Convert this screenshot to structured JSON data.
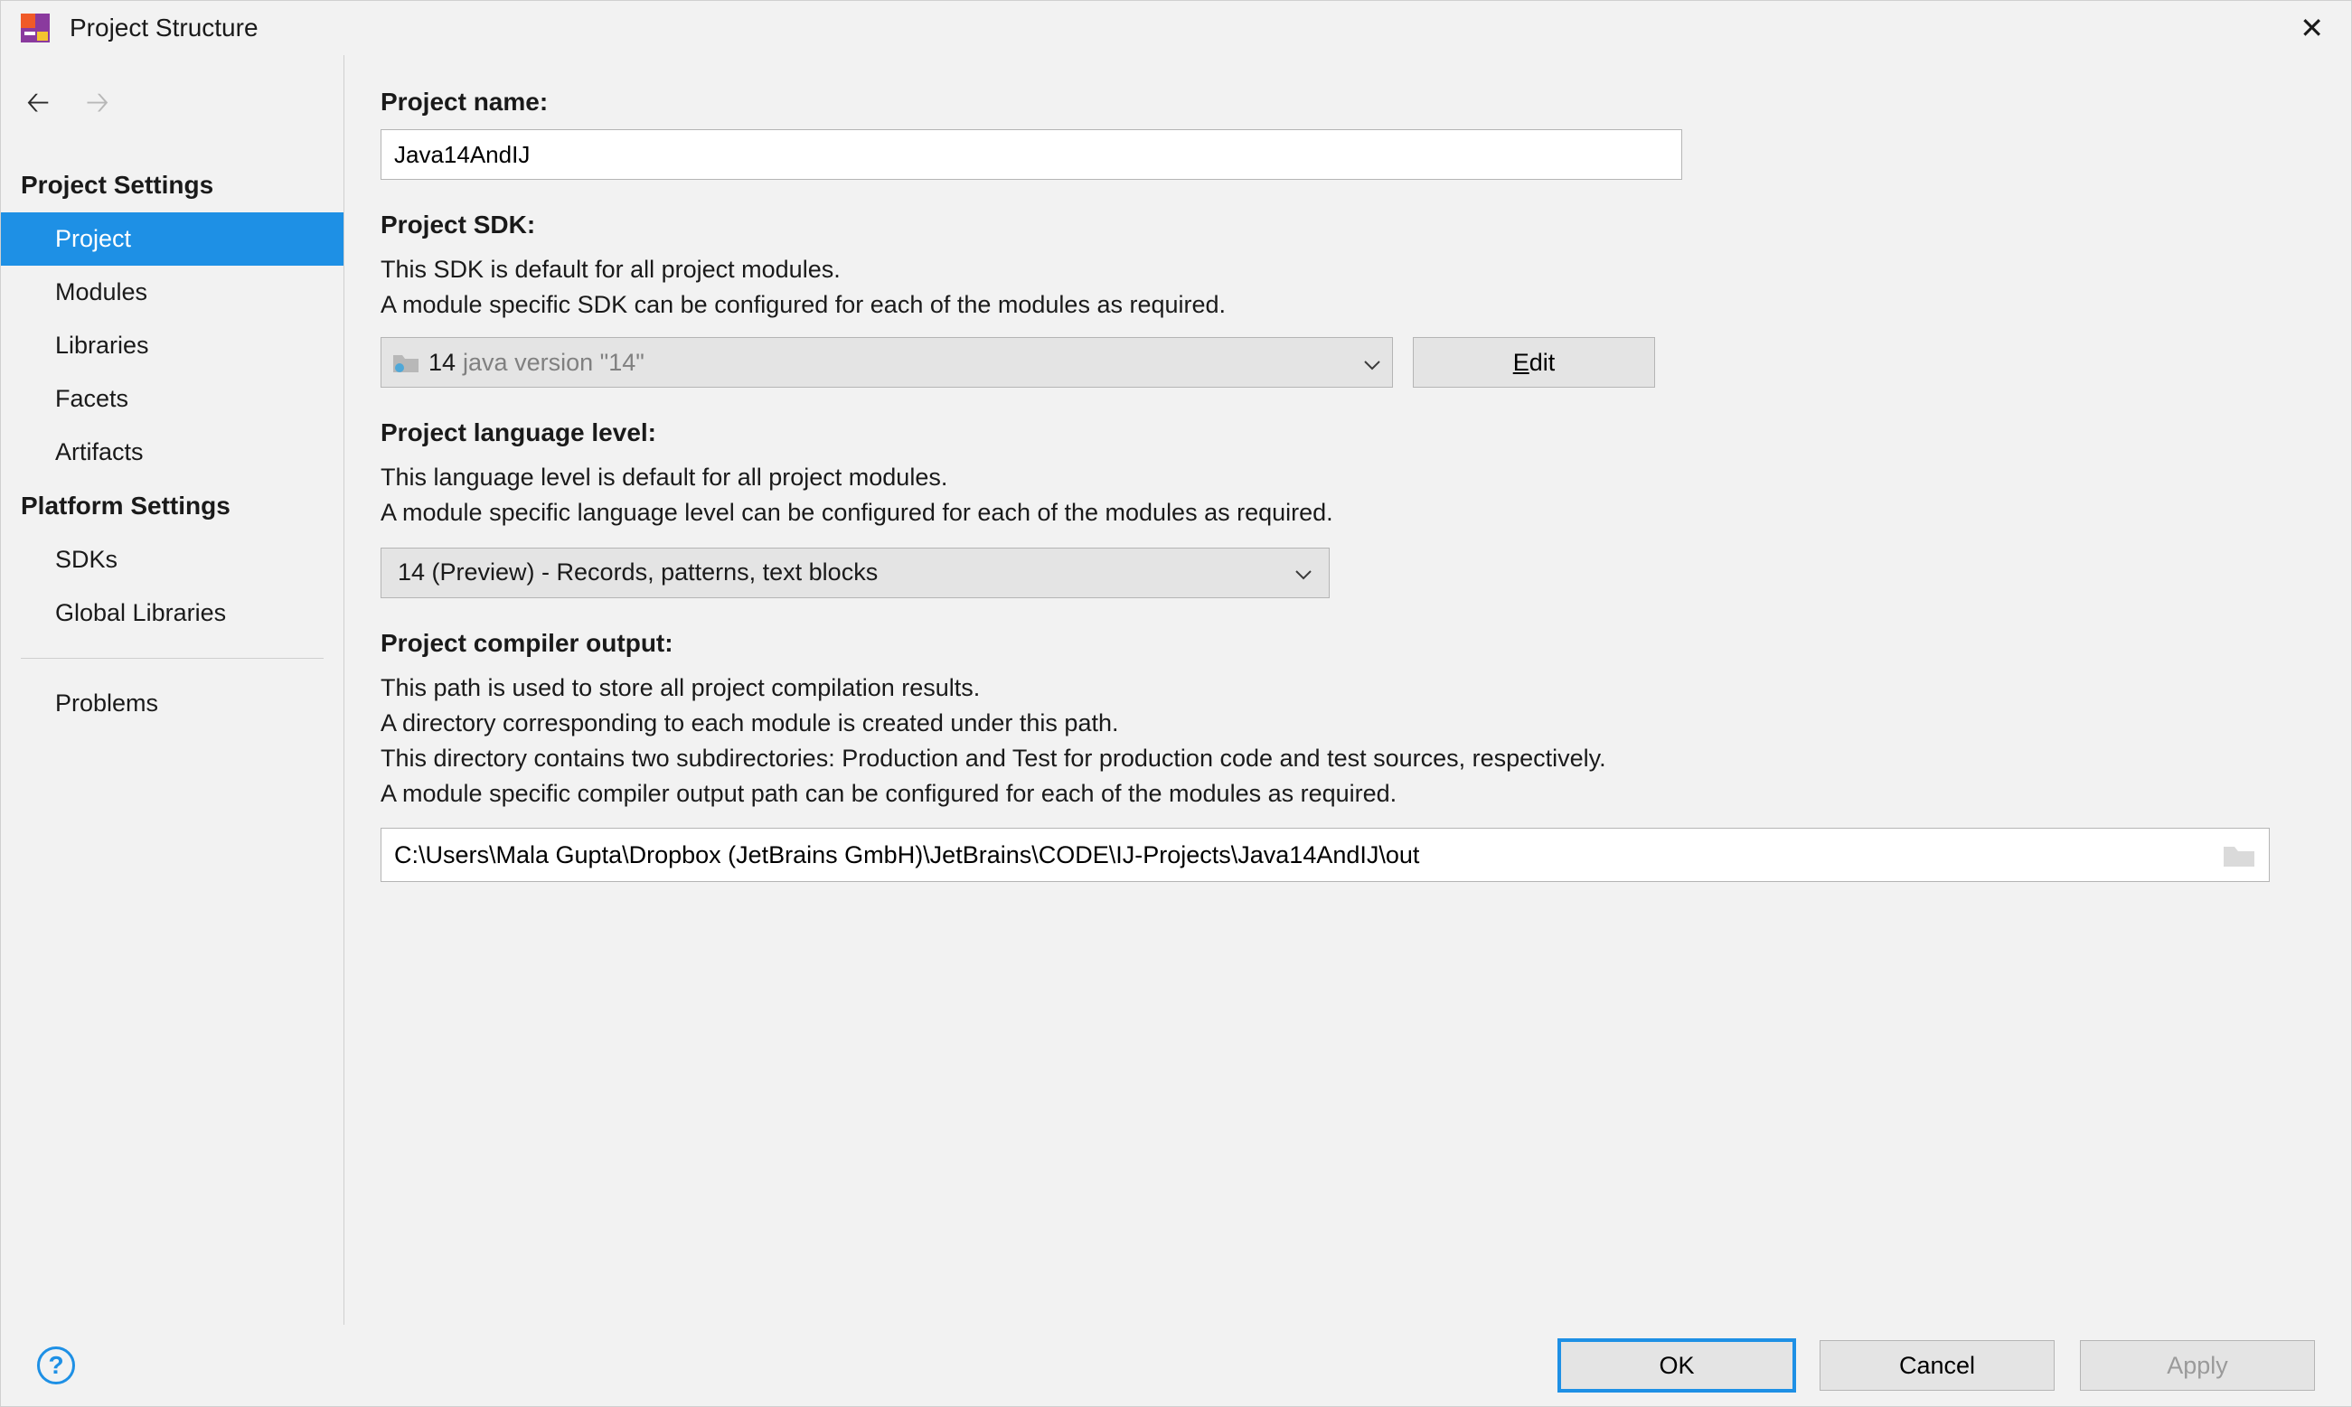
{
  "window": {
    "title": "Project Structure"
  },
  "sidebar": {
    "section1": "Project Settings",
    "items1": [
      "Project",
      "Modules",
      "Libraries",
      "Facets",
      "Artifacts"
    ],
    "section2": "Platform Settings",
    "items2": [
      "SDKs",
      "Global Libraries"
    ],
    "problems": "Problems"
  },
  "project_name": {
    "label": "Project name:",
    "value": "Java14AndIJ"
  },
  "project_sdk": {
    "label": "Project SDK:",
    "desc1": "This SDK is default for all project modules.",
    "desc2": "A module specific SDK can be configured for each of the modules as required.",
    "selected_name": "14",
    "selected_version": "java version \"14\"",
    "edit_label": "Edit"
  },
  "lang_level": {
    "label": "Project language level:",
    "desc1": "This language level is default for all project modules.",
    "desc2": "A module specific language level can be configured for each of the modules as required.",
    "selected": "14 (Preview) - Records, patterns, text blocks"
  },
  "compiler_output": {
    "label": "Project compiler output:",
    "desc1": "This path is used to store all project compilation results.",
    "desc2": "A directory corresponding to each module is created under this path.",
    "desc3": "This directory contains two subdirectories: Production and Test for production code and test sources, respectively.",
    "desc4": "A module specific compiler output path can be configured for each of the modules as required.",
    "value": "C:\\Users\\Mala Gupta\\Dropbox (JetBrains GmbH)\\JetBrains\\CODE\\IJ-Projects\\Java14AndIJ\\out"
  },
  "footer": {
    "ok": "OK",
    "cancel": "Cancel",
    "apply": "Apply"
  }
}
